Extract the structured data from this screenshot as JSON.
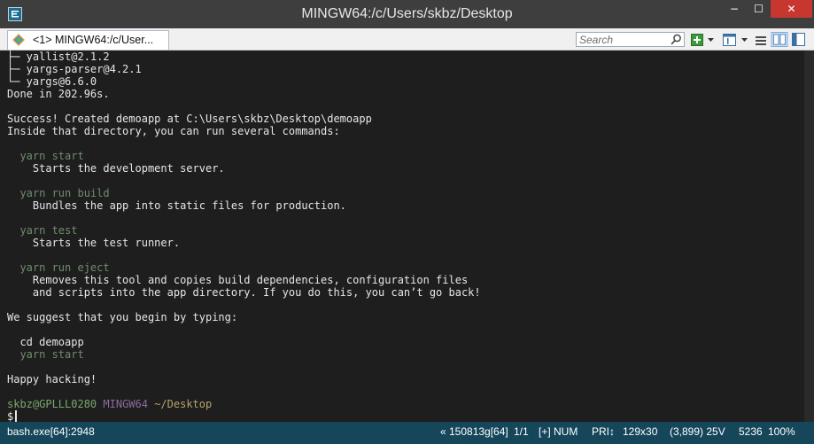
{
  "window": {
    "title": "MINGW64:/c/Users/skbz/Desktop",
    "min_glyph": "−",
    "max_glyph": "☐",
    "close_glyph": "✕"
  },
  "tab": {
    "label": "<1> MINGW64:/c/User..."
  },
  "search": {
    "placeholder": "Search"
  },
  "terminal": {
    "lines": [
      "├─ yallist@2.1.2",
      "├─ yargs-parser@4.2.1",
      "└─ yargs@6.6.0",
      "Done in 202.96s.",
      "",
      "Success! Created demoapp at C:\\Users\\skbz\\Desktop\\demoapp",
      "Inside that directory, you can run several commands:",
      "",
      "  yarn start",
      "    Starts the development server.",
      "",
      "  yarn run build",
      "    Bundles the app into static files for production.",
      "",
      "  yarn test",
      "    Starts the test runner.",
      "",
      "  yarn run eject",
      "    Removes this tool and copies build dependencies, configuration files",
      "    and scripts into the app directory. If you do this, you can’t go back!",
      "",
      "We suggest that you begin by typing:",
      "",
      "  cd demoapp",
      "  yarn start",
      "",
      "Happy hacking!",
      ""
    ],
    "prompt": {
      "user": "skbz@GPLLL0280",
      "env": "MINGW64",
      "cwd": "~/Desktop",
      "symbol": "$"
    }
  },
  "statusbar": {
    "process": "bash.exe[64]:2948",
    "build": "« 150813g[64]",
    "pane": "1/1",
    "keys": "[+] NUM",
    "priority": "PRI↕",
    "size": "129x30",
    "cursor_pos": "(3,899) 25V",
    "pid": "5236",
    "zoom": "100%"
  },
  "colors": {
    "titlebar": "#3e3e3e",
    "close": "#c7372f",
    "terminal_bg": "#1e1e1e",
    "statusbar": "#15465a"
  }
}
